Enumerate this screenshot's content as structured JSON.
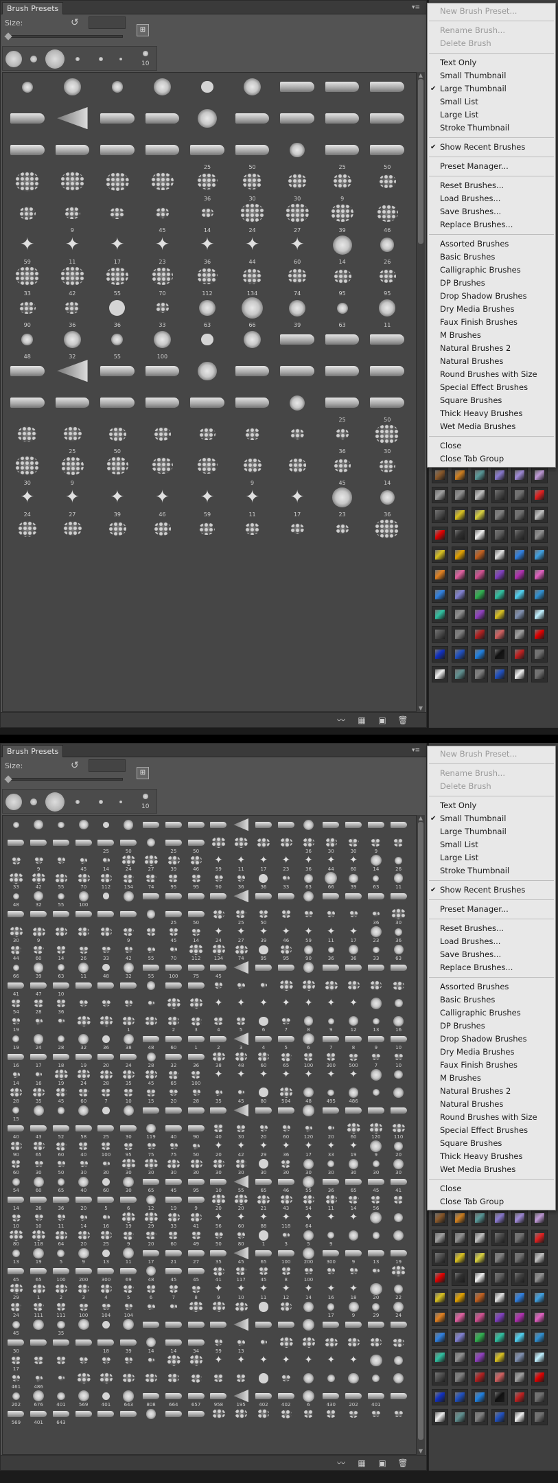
{
  "panel": {
    "tab_title": "Brush Presets",
    "size_label": "Size:",
    "menu_button": "▾≡"
  },
  "recent_brush_label": "10",
  "menu": {
    "items": [
      {
        "label": "New Brush Preset...",
        "disabled": true,
        "checked": false
      },
      {
        "sep": true
      },
      {
        "label": "Rename Brush...",
        "disabled": true,
        "checked": false
      },
      {
        "label": "Delete Brush",
        "disabled": true,
        "checked": false
      },
      {
        "sep": true
      },
      {
        "label": "Text Only",
        "disabled": false,
        "checked": false
      },
      {
        "label": "Small Thumbnail",
        "disabled": false,
        "checked": false
      },
      {
        "label": "Large Thumbnail",
        "disabled": false,
        "checked": false
      },
      {
        "label": "Small List",
        "disabled": false,
        "checked": false
      },
      {
        "label": "Large List",
        "disabled": false,
        "checked": false
      },
      {
        "label": "Stroke Thumbnail",
        "disabled": false,
        "checked": false
      },
      {
        "sep": true
      },
      {
        "label": "Show Recent Brushes",
        "disabled": false,
        "checked": true
      },
      {
        "sep": true
      },
      {
        "label": "Preset Manager...",
        "disabled": false,
        "checked": false
      },
      {
        "sep": true
      },
      {
        "label": "Reset Brushes...",
        "disabled": false,
        "checked": false
      },
      {
        "label": "Load Brushes...",
        "disabled": false,
        "checked": false
      },
      {
        "label": "Save Brushes...",
        "disabled": false,
        "checked": false
      },
      {
        "label": "Replace Brushes...",
        "disabled": false,
        "checked": false
      },
      {
        "sep": true
      },
      {
        "label": "Assorted Brushes",
        "disabled": false,
        "checked": false
      },
      {
        "label": "Basic Brushes",
        "disabled": false,
        "checked": false
      },
      {
        "label": "Calligraphic Brushes",
        "disabled": false,
        "checked": false
      },
      {
        "label": "DP Brushes",
        "disabled": false,
        "checked": false
      },
      {
        "label": "Drop Shadow Brushes",
        "disabled": false,
        "checked": false
      },
      {
        "label": "Dry Media Brushes",
        "disabled": false,
        "checked": false
      },
      {
        "label": "Faux Finish Brushes",
        "disabled": false,
        "checked": false
      },
      {
        "label": "M Brushes",
        "disabled": false,
        "checked": false
      },
      {
        "label": "Natural Brushes 2",
        "disabled": false,
        "checked": false
      },
      {
        "label": "Natural Brushes",
        "disabled": false,
        "checked": false
      },
      {
        "label": "Round Brushes with Size",
        "disabled": false,
        "checked": false
      },
      {
        "label": "Special Effect Brushes",
        "disabled": false,
        "checked": false
      },
      {
        "label": "Square Brushes",
        "disabled": false,
        "checked": false
      },
      {
        "label": "Thick Heavy Brushes",
        "disabled": false,
        "checked": false
      },
      {
        "label": "Wet Media Brushes",
        "disabled": false,
        "checked": false
      },
      {
        "sep": true
      },
      {
        "label": "Close",
        "disabled": false,
        "checked": false
      },
      {
        "label": "Close Tab Group",
        "disabled": false,
        "checked": false
      }
    ]
  },
  "large_view": {
    "checked_view": "Large Thumbnail",
    "numbers": [
      "",
      "",
      "",
      "",
      "",
      "",
      "",
      "",
      "",
      "",
      "",
      "",
      "",
      "",
      "",
      "",
      "",
      "",
      "",
      "",
      "",
      "",
      "25",
      "50",
      "",
      "25",
      "50",
      "",
      "",
      "",
      "",
      "36",
      "30",
      "30",
      "9",
      "",
      "",
      "9",
      "",
      "45",
      "14",
      "24",
      "27",
      "39",
      "46",
      "59",
      "11",
      "17",
      "23",
      "36",
      "44",
      "60",
      "14",
      "26",
      "33",
      "42",
      "55",
      "70",
      "112",
      "134",
      "74",
      "95",
      "95",
      "90",
      "36",
      "36",
      "33",
      "63",
      "66",
      "39",
      "63",
      "11",
      "48",
      "32",
      "55",
      "100",
      "",
      "",
      "",
      "",
      "",
      "",
      "",
      "",
      "",
      "",
      "",
      "",
      "",
      "",
      "",
      "",
      "",
      "",
      "",
      "",
      "",
      "25",
      "50",
      "",
      "25",
      "50",
      "",
      "",
      "",
      "",
      "36",
      "30",
      "30",
      "9",
      "",
      "",
      "",
      "9",
      "",
      "45",
      "14",
      "24",
      "27",
      "39",
      "46",
      "59",
      "11",
      "17",
      "23",
      "36",
      "",
      "",
      "",
      "",
      "",
      "",
      "",
      "",
      ""
    ]
  },
  "small_view": {
    "checked_view": "Small Thumbnail",
    "numbers": [
      "",
      "",
      "",
      "",
      "",
      "",
      "",
      "",
      "",
      "",
      "",
      "",
      "",
      "",
      "",
      "",
      "",
      "",
      "",
      "",
      "",
      "",
      "25",
      "50",
      "",
      "25",
      "50",
      "",
      "",
      "",
      "",
      "36",
      "30",
      "30",
      "9",
      "",
      "",
      "9",
      "",
      "45",
      "14",
      "24",
      "27",
      "39",
      "46",
      "59",
      "11",
      "17",
      "23",
      "36",
      "44",
      "60",
      "14",
      "26",
      "33",
      "42",
      "55",
      "70",
      "112",
      "134",
      "74",
      "95",
      "95",
      "90",
      "36",
      "36",
      "33",
      "63",
      "66",
      "39",
      "63",
      "11",
      "48",
      "32",
      "55",
      "100",
      "",
      "",
      "",
      "",
      "",
      "",
      "",
      "",
      "",
      "",
      "",
      "",
      "",
      "",
      "",
      "",
      "",
      "",
      "",
      "",
      "",
      "25",
      "50",
      "",
      "25",
      "50",
      "",
      "",
      "",
      "",
      "36",
      "30",
      "30",
      "9",
      "",
      "",
      "",
      "9",
      "",
      "45",
      "14",
      "24",
      "27",
      "39",
      "46",
      "59",
      "11",
      "17",
      "23",
      "36",
      "44",
      "60",
      "14",
      "26",
      "33",
      "42",
      "55",
      "70",
      "112",
      "134",
      "74",
      "95",
      "95",
      "90",
      "36",
      "36",
      "33",
      "63",
      "66",
      "39",
      "63",
      "11",
      "48",
      "32",
      "55",
      "100",
      "75",
      "45",
      "",
      "",
      "",
      "",
      "",
      "",
      "",
      "",
      "41",
      "47",
      "10",
      "",
      "",
      "",
      "",
      "",
      "",
      "",
      "",
      "",
      "",
      "",
      "",
      "",
      "",
      "",
      "54",
      "28",
      "36",
      "",
      "",
      "",
      "",
      "",
      "",
      "",
      "",
      "",
      "",
      "",
      "",
      "",
      "",
      "",
      "19",
      "",
      "",
      "",
      "",
      "1",
      "",
      "2",
      "3",
      "4",
      "5",
      "6",
      "7",
      "8",
      "9",
      "12",
      "13",
      "16",
      "19",
      "24",
      "28",
      "32",
      "36",
      "38",
      "48",
      "60",
      "1",
      "2",
      "3",
      "4",
      "5",
      "6",
      "7",
      "8",
      "9",
      "10",
      "16",
      "17",
      "18",
      "19",
      "20",
      "24",
      "28",
      "32",
      "36",
      "38",
      "48",
      "60",
      "65",
      "100",
      "300",
      "500",
      "7",
      "10",
      "14",
      "16",
      "19",
      "24",
      "28",
      "35",
      "45",
      "65",
      "100",
      "",
      "",
      "",
      "",
      "",
      "",
      "",
      "",
      "",
      "28",
      "35",
      "45",
      "60",
      "7",
      "10",
      "15",
      "20",
      "28",
      "35",
      "45",
      "80",
      "504",
      "48",
      "495",
      "486",
      "",
      "",
      "15",
      "",
      "",
      "",
      "",
      "",
      "",
      "",
      "",
      "",
      "",
      "",
      "",
      "",
      "",
      "",
      "",
      "",
      "40",
      "43",
      "52",
      "58",
      "25",
      "30",
      "119",
      "40",
      "90",
      "40",
      "30",
      "20",
      "60",
      "120",
      "20",
      "60",
      "120",
      "110",
      "90",
      "65",
      "60",
      "40",
      "100",
      "95",
      "75",
      "75",
      "50",
      "20",
      "42",
      "29",
      "36",
      "17",
      "33",
      "19",
      "9",
      "20",
      "60",
      "30",
      "50",
      "30",
      "30",
      "30",
      "30",
      "30",
      "30",
      "30",
      "30",
      "30",
      "30",
      "30",
      "30",
      "30",
      "30",
      "30",
      "54",
      "60",
      "65",
      "40",
      "60",
      "30",
      "65",
      "45",
      "95",
      "10",
      "55",
      "65",
      "46",
      "55",
      "36",
      "65",
      "45",
      "41",
      "14",
      "26",
      "36",
      "20",
      "5",
      "6",
      "12",
      "19",
      "9",
      "20",
      "20",
      "21",
      "43",
      "54",
      "11",
      "14",
      "56",
      "",
      "10",
      "10",
      "11",
      "14",
      "16",
      "19",
      "29",
      "33",
      "41",
      "56",
      "60",
      "88",
      "118",
      "64",
      "",
      "",
      "",
      "",
      "80",
      "118",
      "64",
      "20",
      "25",
      "9",
      "20",
      "60",
      "49",
      "50",
      "80",
      "1",
      "3",
      "5",
      "9",
      "",
      "",
      "",
      "13",
      "19",
      "5",
      "9",
      "13",
      "11",
      "17",
      "21",
      "27",
      "35",
      "45",
      "65",
      "100",
      "200",
      "300",
      "9",
      "13",
      "19",
      "45",
      "65",
      "100",
      "200",
      "300",
      "69",
      "48",
      "45",
      "45",
      "41",
      "117",
      "45",
      "8",
      "100",
      "",
      "",
      "",
      "",
      "29",
      "1",
      "2",
      "3",
      "4",
      "5",
      "6",
      "7",
      "8",
      "9",
      "10",
      "11",
      "12",
      "14",
      "16",
      "18",
      "20",
      "22",
      "24",
      "111",
      "111",
      "100",
      "104",
      "104",
      "",
      "",
      "",
      "",
      "",
      "",
      "",
      "",
      "17",
      "9",
      "29",
      "24",
      "45",
      "",
      "35",
      "",
      "",
      "",
      "",
      "",
      "",
      "",
      "",
      "",
      "",
      "",
      "",
      "",
      "",
      "",
      "30",
      "",
      "",
      "",
      "18",
      "39",
      "14",
      "14",
      "34",
      "59",
      "13",
      "",
      "",
      "",
      "",
      "",
      "",
      "",
      "17",
      "",
      "",
      "",
      "",
      "",
      "",
      "",
      "",
      "",
      "",
      "",
      "",
      "",
      "",
      "",
      "",
      "",
      "461",
      "486",
      "",
      "",
      "",
      "",
      "",
      "",
      "",
      "",
      "",
      "",
      "",
      "",
      "",
      "",
      "",
      "",
      "202",
      "676",
      "401",
      "569",
      "401",
      "643",
      "808",
      "664",
      "657",
      "958",
      "195",
      "402",
      "402",
      "6",
      "430",
      "202",
      "401",
      "",
      "569",
      "401",
      "643",
      "",
      "",
      "",
      "",
      "",
      "",
      "",
      "",
      "",
      "",
      "",
      "",
      "",
      "",
      ""
    ]
  },
  "swatch_colors": [
    "#8b5a2b",
    "#d08020",
    "#5a9a9a",
    "#8a7ad0",
    "#a08ad8",
    "#c09ad8",
    "#a0a0a0",
    "#909090",
    "#c0c0c0",
    "#4a4a4a",
    "#707070",
    "#e02020",
    "#505050",
    "#d8c020",
    "#d8d040",
    "#808080",
    "#707070",
    "#c0c0c0",
    "#e00000",
    "#303030",
    "#f0f0f0",
    "#606060",
    "#404040",
    "#909090",
    "#d8c020",
    "#e0a000",
    "#c06020",
    "#e0e0e0",
    "#3080e0",
    "#40a0e0",
    "#e08020",
    "#e060a0",
    "#d05090",
    "#8040c0",
    "#b030b0",
    "#e060c0",
    "#3080e0",
    "#8080d0",
    "#30b050",
    "#30c0a0",
    "#50d0f0",
    "#3090d0",
    "#30c0a0",
    "#909090",
    "#9040c0",
    "#d8c020",
    "#8090b0",
    "#c0f0ff",
    "#505050",
    "#808080",
    "#b02020",
    "#d06060",
    "#a0a0a0",
    "#e00000",
    "#1030c0",
    "#2050c0",
    "#2080e0",
    "#101010",
    "#c02020",
    "#707070",
    "#f0f0f0",
    "#609090",
    "#808080",
    "#2050c0",
    "#f0f0f0",
    "#707070"
  ]
}
